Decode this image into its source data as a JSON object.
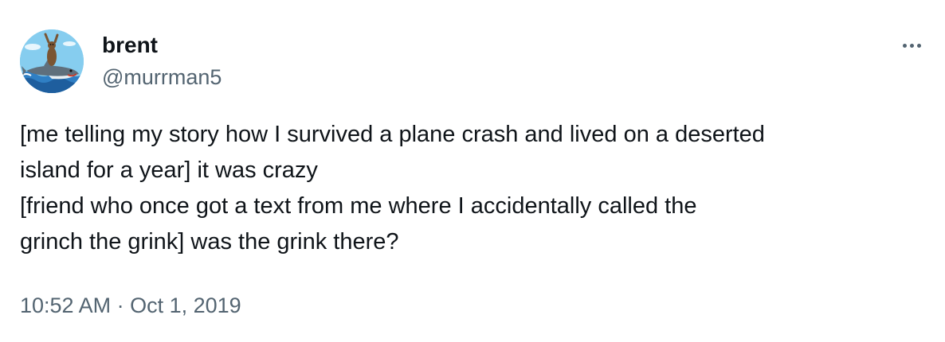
{
  "author": {
    "display_name": "brent",
    "handle": "@murrman5",
    "avatar_icon": "otter-riding-shark-avatar"
  },
  "more_menu": {
    "icon": "more-horizontal-icon"
  },
  "tweet": {
    "lines": [
      "[me telling my story how I survived a plane crash and lived on a deserted",
      "island for a year] it was crazy",
      "[friend who once got a text from me where I accidentally called the",
      "grinch the grink] was the grink there?"
    ],
    "time": "10:52 AM",
    "separator": "·",
    "date": "Oct 1, 2019"
  },
  "colors": {
    "text": "#0f1419",
    "secondary": "#536471",
    "background": "#ffffff"
  }
}
